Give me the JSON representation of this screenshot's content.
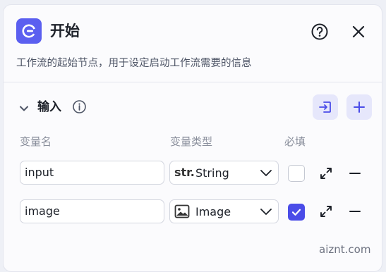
{
  "header": {
    "title": "开始",
    "icon": "start-node-icon",
    "accent_color": "#5b5ff0"
  },
  "description": "工作流的起始节点，用于设定启动工作流需要的信息",
  "inputs_section": {
    "label": "输入",
    "columns": {
      "name": "变量名",
      "type": "变量类型",
      "required": "必填"
    },
    "rows": [
      {
        "name": "input",
        "type_icon_text": "str.",
        "type_label": "String",
        "required": false
      },
      {
        "name": "image",
        "type_icon_text": "",
        "type_label": "Image",
        "required": true
      }
    ]
  },
  "watermark": "aiznt.com"
}
